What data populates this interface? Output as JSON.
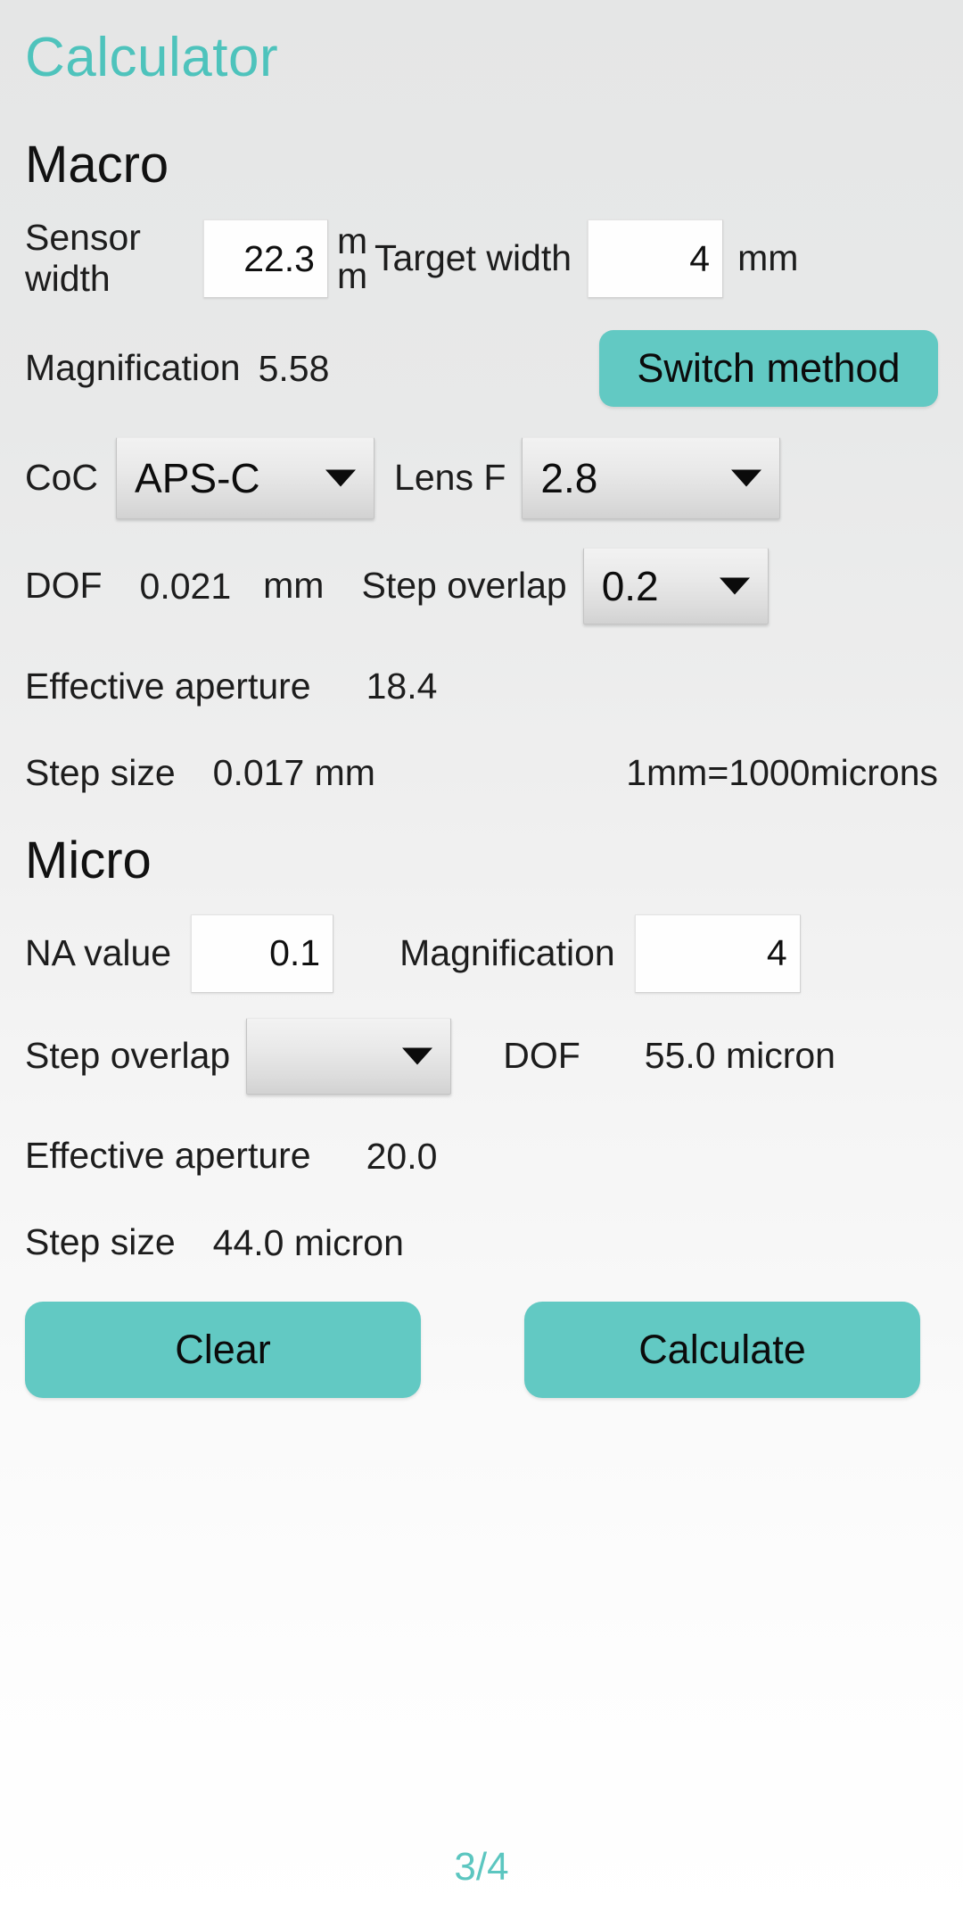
{
  "app": {
    "title": "Calculator",
    "accent_color": "#62c9c3",
    "background_top": "#e5e6e6",
    "background_bottom": "#ffffff"
  },
  "macro": {
    "heading": "Macro",
    "sensor_width": {
      "label": "Sensor\nwidth",
      "value": "22.3",
      "unit": "mm"
    },
    "target_width": {
      "label": "Target width",
      "value": "4",
      "unit": "mm"
    },
    "magnification": {
      "label": "Magnification",
      "value": "5.58"
    },
    "switch_method_label": "Switch method",
    "coc": {
      "label": "CoC",
      "value": "APS-C"
    },
    "lens_f": {
      "label": "Lens F",
      "value": "2.8"
    },
    "dof": {
      "label": "DOF",
      "value": "0.021",
      "unit": "mm"
    },
    "step_overlap": {
      "label": "Step overlap",
      "value": "0.2"
    },
    "effective_aperture": {
      "label": "Effective aperture",
      "value": "18.4"
    },
    "step_size": {
      "label": "Step size",
      "value": "0.017 mm"
    },
    "conversion_note": "1mm=1000microns"
  },
  "micro": {
    "heading": "Micro",
    "na_value": {
      "label": "NA value",
      "value": "0.1"
    },
    "magnification": {
      "label": "Magnification",
      "value": "4"
    },
    "step_overlap": {
      "label": "Step overlap",
      "value": ""
    },
    "dof": {
      "label": "DOF",
      "value": "55.0 micron"
    },
    "effective_aperture": {
      "label": "Effective aperture",
      "value": "20.0"
    },
    "step_size": {
      "label": "Step size",
      "value": "44.0 micron"
    }
  },
  "actions": {
    "clear_label": "Clear",
    "calculate_label": "Calculate"
  },
  "footer": {
    "page_indicator": "3/4"
  }
}
